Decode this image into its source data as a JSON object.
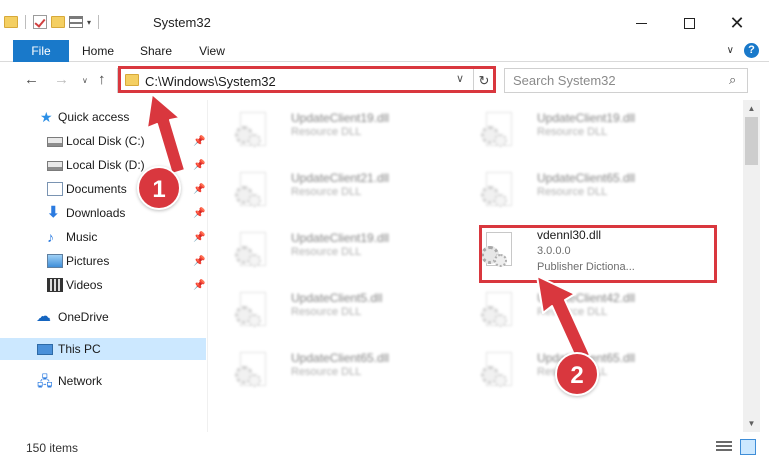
{
  "window": {
    "title": "System32",
    "caret": "▾"
  },
  "ribbon": {
    "tabs": [
      "File",
      "Home",
      "Share",
      "View"
    ],
    "expand_glyph": "∨",
    "help_glyph": "?"
  },
  "nav": {
    "back_glyph": "←",
    "forward_glyph": "→",
    "recent_glyph": "∨",
    "up_glyph": "↑",
    "address": "C:\\Windows\\System32",
    "address_dropdown_glyph": "∨",
    "refresh_glyph": "↻",
    "search_placeholder": "Search System32",
    "search_glyph": "⌕"
  },
  "sidebar": {
    "pin_glyph": "★",
    "items": [
      {
        "label": "Quick access",
        "icon": "star-icon"
      },
      {
        "label": "Local Disk (C:)",
        "icon": "drive-icon",
        "pinned": true
      },
      {
        "label": "Local Disk (D:)",
        "icon": "drive-icon",
        "pinned": true
      },
      {
        "label": "Documents",
        "icon": "documents-icon",
        "pinned": true
      },
      {
        "label": "Downloads",
        "icon": "downloads-icon",
        "pinned": true
      },
      {
        "label": "Music",
        "icon": "music-icon",
        "pinned": true
      },
      {
        "label": "Pictures",
        "icon": "pictures-icon",
        "pinned": true
      },
      {
        "label": "Videos",
        "icon": "videos-icon",
        "pinned": true
      },
      {
        "label": "OneDrive",
        "icon": "cloud-icon"
      },
      {
        "label": "This PC",
        "icon": "computer-icon",
        "selected": true
      },
      {
        "label": "Network",
        "icon": "network-icon"
      }
    ]
  },
  "files": [
    {
      "name": "UpdateClient19.dll",
      "desc": "Resource DLL",
      "blurred": true
    },
    {
      "name": "UpdateClient19.dll",
      "desc": "Resource DLL",
      "blurred": true
    },
    {
      "name": "UpdateClient21.dll",
      "desc": "Resource DLL",
      "blurred": true
    },
    {
      "name": "UpdateClient65.dll",
      "desc": "Resource DLL",
      "blurred": true
    },
    {
      "name": "UpdateClient19.dll",
      "desc": "Resource DLL",
      "blurred": true
    },
    {
      "name": "vdennl30.dll",
      "desc": "3.0.0.0",
      "publisher": "Publisher   Dictiona...",
      "blurred": false
    },
    {
      "name": "UpdateClient5.dll",
      "desc": "Resource DLL",
      "blurred": true
    },
    {
      "name": "UpdateClient42.dll",
      "desc": "Resource DLL",
      "blurred": true
    },
    {
      "name": "UpdateClient65.dll",
      "desc": "Resource DLL",
      "blurred": true
    },
    {
      "name": "UpdateClient65.dll",
      "desc": "Resource DLL",
      "blurred": true
    }
  ],
  "scrollbar": {
    "up_glyph": "▲",
    "down_glyph": "▼"
  },
  "status": {
    "item_count": "150 items"
  },
  "annotations": {
    "step1": "1",
    "step2": "2",
    "color": "#d9373e"
  },
  "colors": {
    "accent": "#1979ca",
    "selection": "#cce8ff"
  }
}
